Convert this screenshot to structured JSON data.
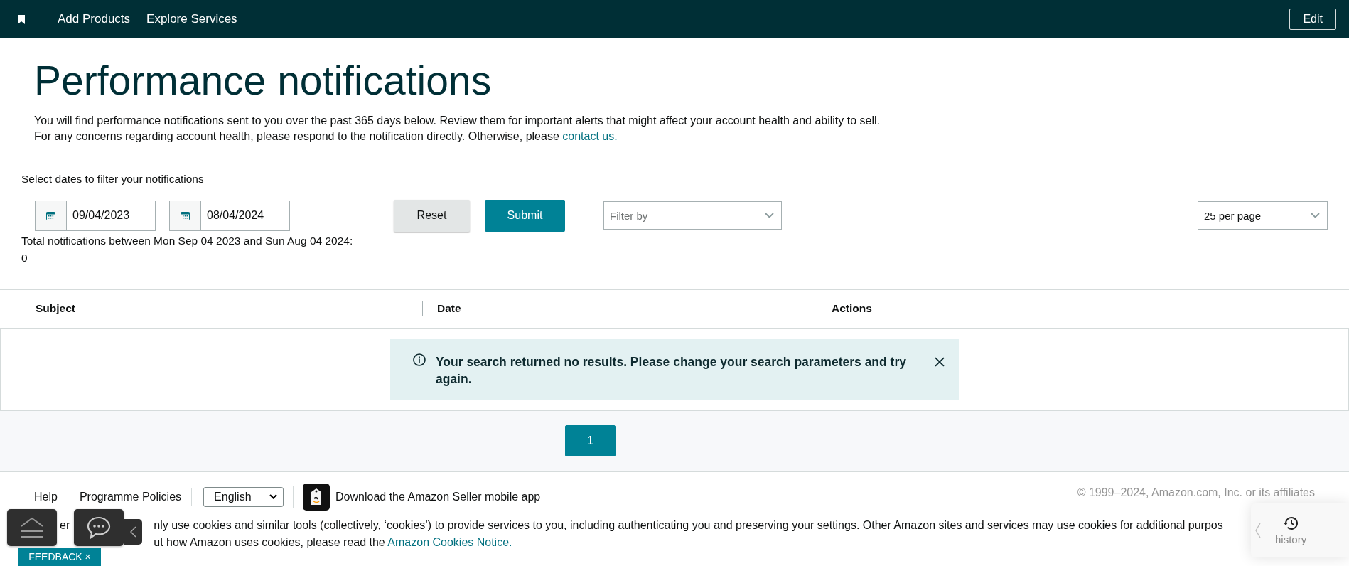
{
  "top_nav": {
    "links": [
      "Add Products",
      "Explore Services"
    ],
    "edit_button": "Edit"
  },
  "page": {
    "title": "Performance notifications",
    "intro": "You will find performance notifications sent to you over the past 365 days below. Review them for important alerts that might affect your account health and ability to sell. For any concerns regarding account health, please respond to the notification directly. Otherwise, please",
    "intro_link": "contact us."
  },
  "filters": {
    "label": "Select dates to filter your notifications",
    "start_date": "09/04/2023",
    "end_date": "08/04/2024",
    "reset": "Reset",
    "submit": "Submit",
    "filter_by": {
      "placeholder": "Filter by"
    },
    "per_page": "25 per page",
    "total": "Total notifications between Mon Sep 04 2023 and Sun Aug 04 2024:",
    "total_count": "0"
  },
  "table": {
    "columns": [
      "Subject",
      "Date",
      "Actions"
    ],
    "alert": "Your search returned no results. Please change your search parameters and try again."
  },
  "pagination": [
    {
      "label": "1",
      "selected": true
    }
  ],
  "footer": {
    "links": [
      "Help",
      "Programme Policies"
    ],
    "language": "English",
    "app_text": "Download the Amazon Seller mobile app",
    "copyright": "© 1999–2024, Amazon.com, Inc. or its affiliates",
    "cookie_fragment": "er",
    "cookie_line_1": "nly use cookies and similar tools (collectively, ‘cookies’) to provide services to you, including authenticating you and preserving your settings. Other Amazon sites and services may use cookies for additional purpos",
    "cookie_line_2": "ut how Amazon uses cookies, please read the",
    "cookie_link": "Amazon Cookies Notice."
  },
  "widgets": {
    "feedback": "FEEDBACK ×",
    "history": "history"
  }
}
